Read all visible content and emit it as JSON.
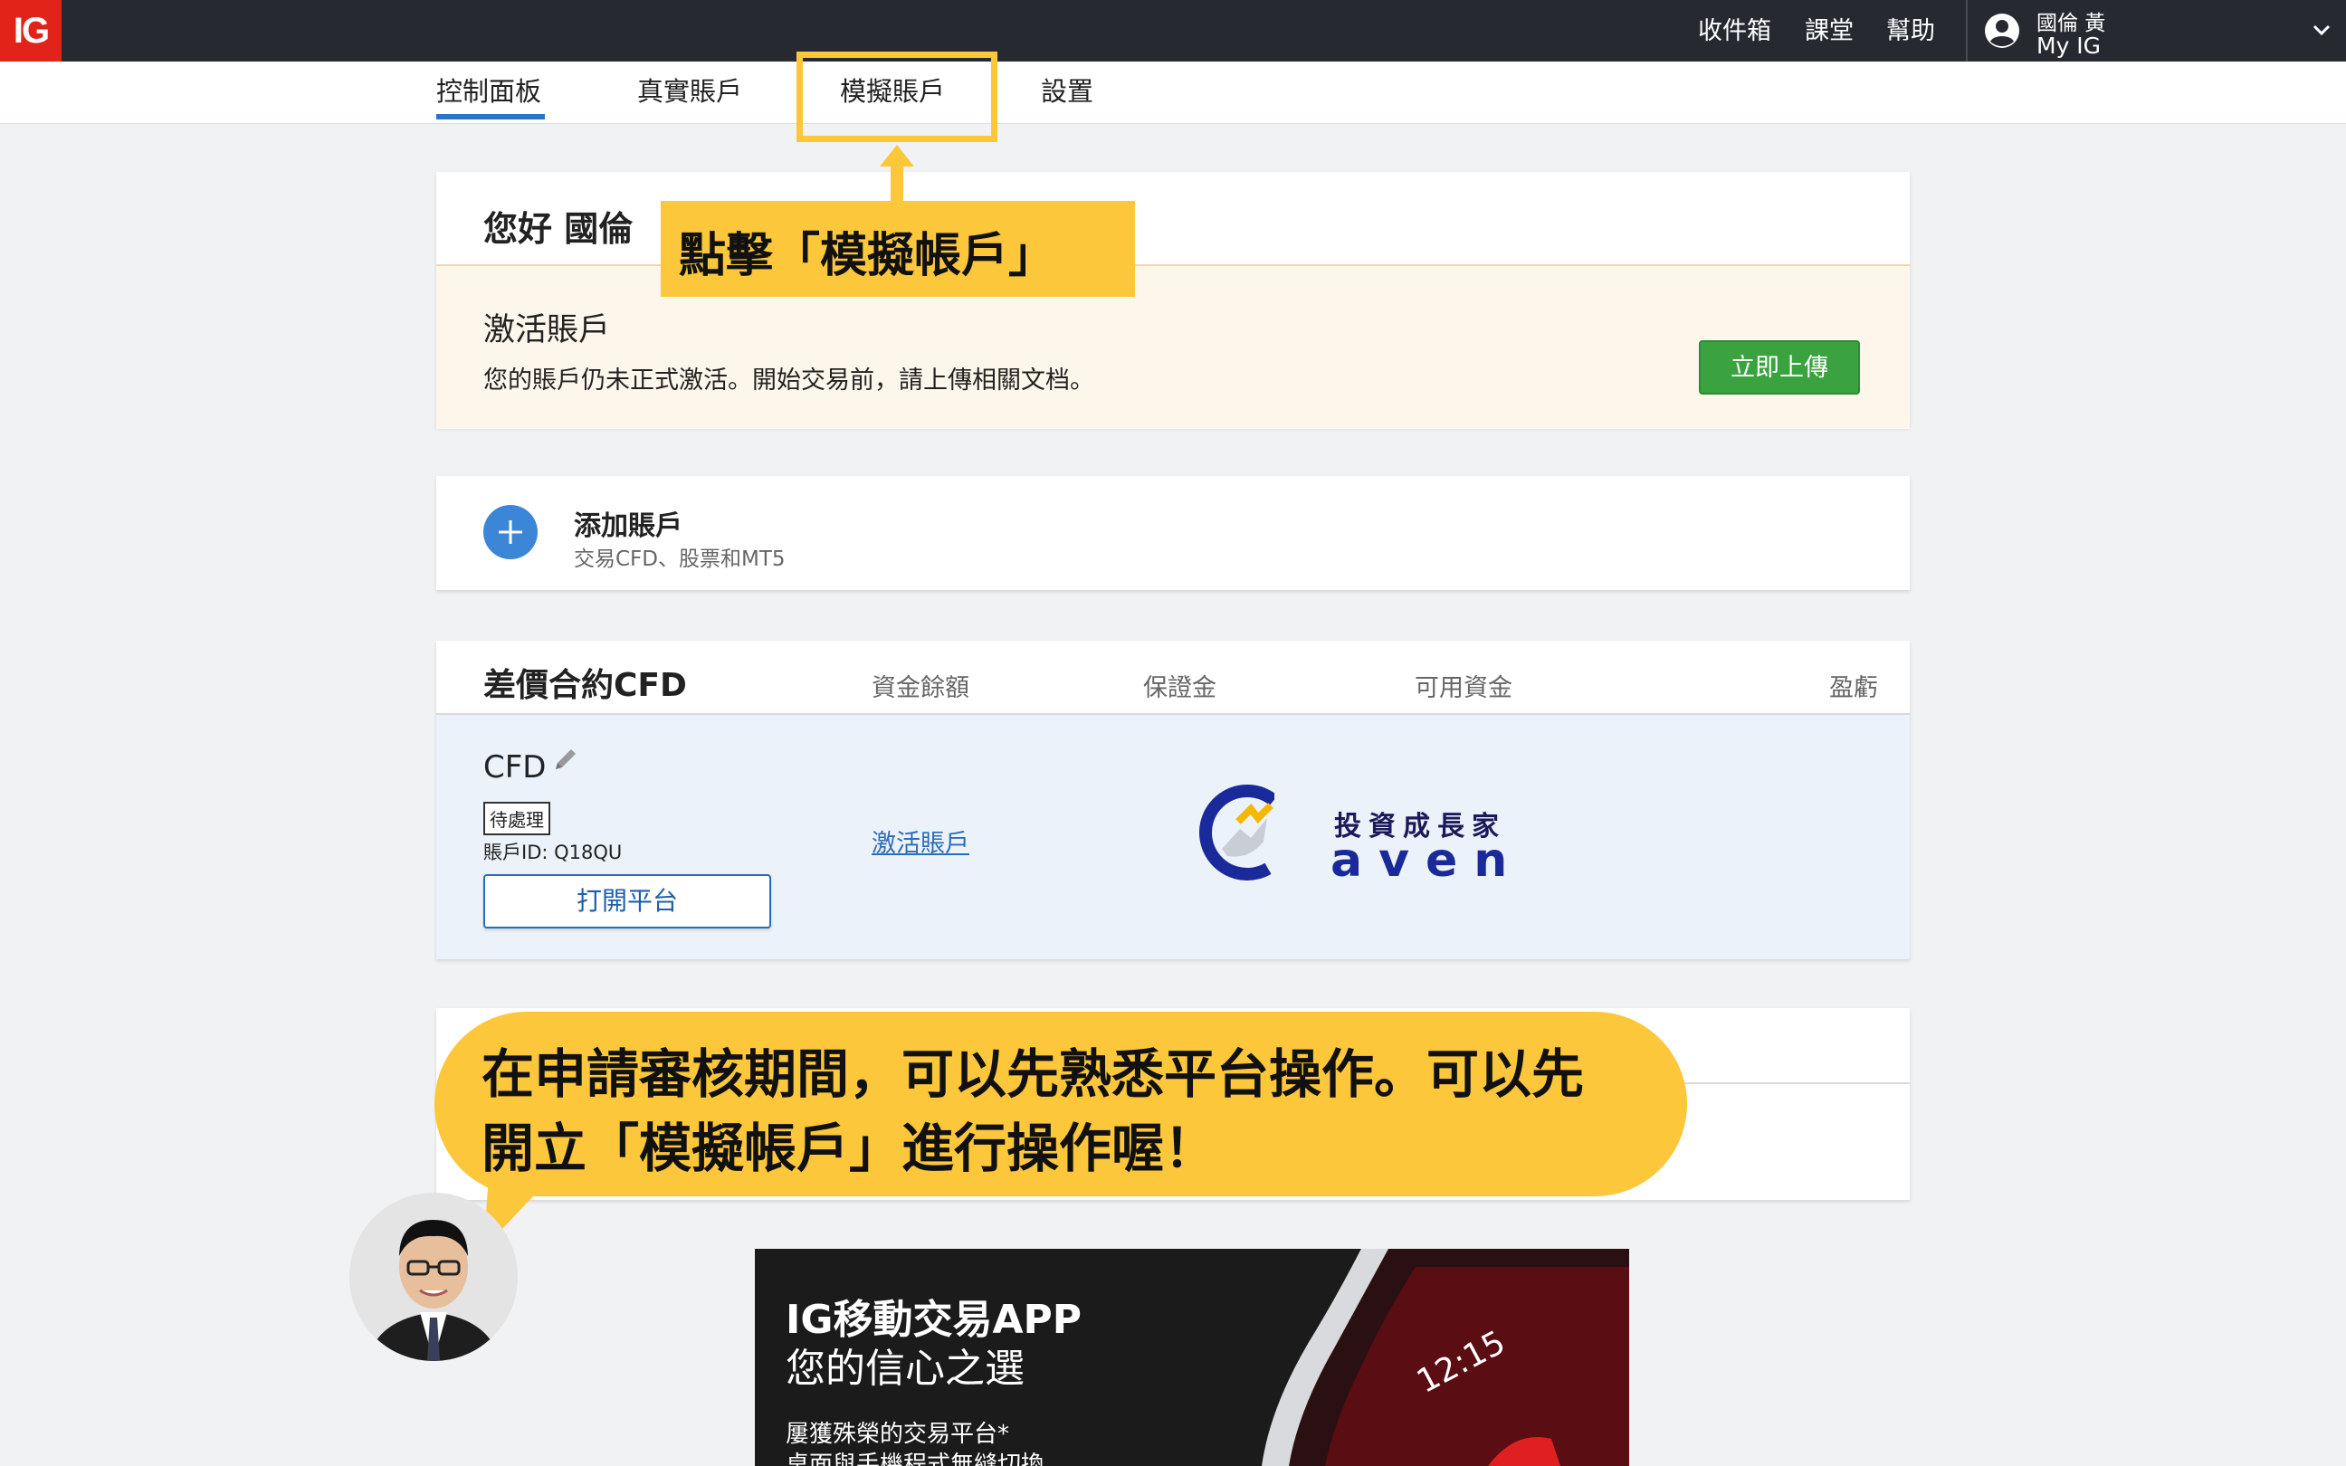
{
  "topbar": {
    "logo": "IG",
    "inbox": "收件箱",
    "classroom": "課堂",
    "help": "幫助",
    "user_name": "國倫 黃",
    "my_ig": "My IG"
  },
  "tabs": [
    "控制面板",
    "真實賬戶",
    "模擬賬戶",
    "設置"
  ],
  "greeting": "您好 國倫",
  "activate": {
    "title": "激活賬戶",
    "description": "您的賬戶仍未正式激活。開始交易前，請上傳相關文档。",
    "button": "立即上傳"
  },
  "add_account": {
    "title": "添加賬戶",
    "subtitle": "交易CFD、股票和MT5"
  },
  "cfd_section": {
    "title": "差價合約CFD",
    "columns": [
      "資金餘額",
      "保證金",
      "可用資金",
      "盈虧"
    ],
    "account_name": "CFD",
    "status": "待處理",
    "account_id": "賬戶ID: Q18QU",
    "open_button": "打開平台",
    "activate_link": "激活賬戶"
  },
  "brand": {
    "name_cn": "投資成長家",
    "name_en": "aven"
  },
  "ad": {
    "title1": "IG移動交易APP",
    "title2": "您的信心之選",
    "line1": "屢獲殊榮的交易平台*",
    "line2": "桌面與手機程式無縫切換，",
    "clock": "12:15"
  },
  "annotations": {
    "callout_small": "點擊「模擬帳戶」",
    "bubble_line1": "在申請審核期間，可以先熟悉平台操作。可以先",
    "bubble_line2": "開立「模擬帳戶」進行操作喔！"
  },
  "colors": {
    "topbar": "#262a30",
    "logo_red": "#e2231a",
    "accent_blue": "#2b74c8",
    "upload_green": "#3aa33f",
    "callout_yellow": "#fcc73a"
  }
}
